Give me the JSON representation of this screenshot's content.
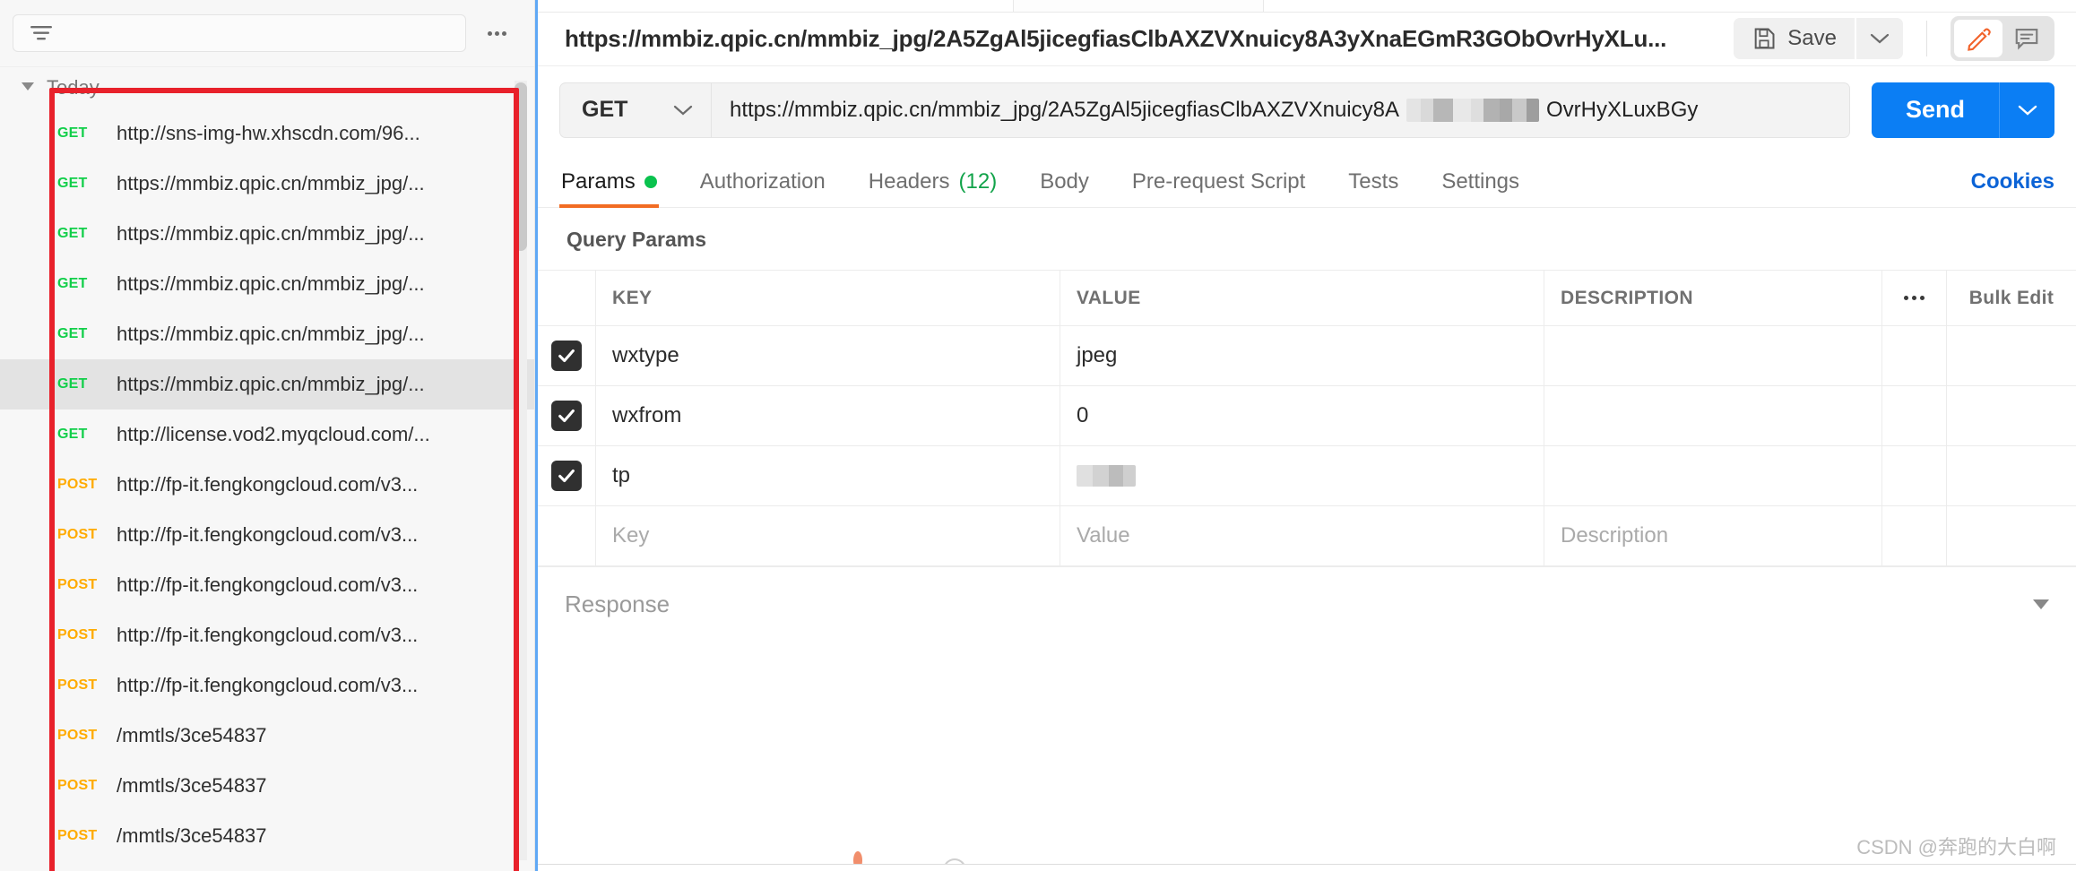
{
  "sidebar": {
    "filter_placeholder": "",
    "more_label": "more-options",
    "group": {
      "label": "Today"
    },
    "items": [
      {
        "method": "GET",
        "url": "http://sns-img-hw.xhscdn.com/96..."
      },
      {
        "method": "GET",
        "url": "https://mmbiz.qpic.cn/mmbiz_jpg/..."
      },
      {
        "method": "GET",
        "url": "https://mmbiz.qpic.cn/mmbiz_jpg/..."
      },
      {
        "method": "GET",
        "url": "https://mmbiz.qpic.cn/mmbiz_jpg/..."
      },
      {
        "method": "GET",
        "url": "https://mmbiz.qpic.cn/mmbiz_jpg/..."
      },
      {
        "method": "GET",
        "url": "https://mmbiz.qpic.cn/mmbiz_jpg/...",
        "selected": true
      },
      {
        "method": "GET",
        "url": "http://license.vod2.myqcloud.com/..."
      },
      {
        "method": "POST",
        "url": "http://fp-it.fengkongcloud.com/v3..."
      },
      {
        "method": "POST",
        "url": "http://fp-it.fengkongcloud.com/v3..."
      },
      {
        "method": "POST",
        "url": "http://fp-it.fengkongcloud.com/v3..."
      },
      {
        "method": "POST",
        "url": "http://fp-it.fengkongcloud.com/v3..."
      },
      {
        "method": "POST",
        "url": "http://fp-it.fengkongcloud.com/v3..."
      },
      {
        "method": "POST",
        "url": "/mmtls/3ce54837"
      },
      {
        "method": "POST",
        "url": "/mmtls/3ce54837"
      },
      {
        "method": "POST",
        "url": "/mmtls/3ce54837"
      }
    ]
  },
  "request": {
    "title": "https://mmbiz.qpic.cn/mmbiz_jpg/2A5ZgAl5jicegfiasClbAXZVXnuicy8A3yXnaEGmR3GObOvrHyXLu...",
    "save_label": "Save",
    "method": "GET",
    "url_prefix": "https://mmbiz.qpic.cn/mmbiz_jpg/2A5ZgAl5jicegfiasClbAXZVXnuicy8A",
    "url_suffix": "OvrHyXLuxBGy",
    "send_label": "Send",
    "cookies_label": "Cookies"
  },
  "tabs": [
    {
      "label": "Params",
      "active": true,
      "dot": true
    },
    {
      "label": "Authorization",
      "active": false
    },
    {
      "label": "Headers",
      "active": false,
      "count": "(12)"
    },
    {
      "label": "Body",
      "active": false
    },
    {
      "label": "Pre-request Script",
      "active": false
    },
    {
      "label": "Tests",
      "active": false
    },
    {
      "label": "Settings",
      "active": false
    }
  ],
  "params": {
    "section_title": "Query Params",
    "columns": {
      "key": "KEY",
      "value": "VALUE",
      "description": "DESCRIPTION",
      "bulk_edit": "Bulk Edit"
    },
    "rows": [
      {
        "checked": true,
        "key": "wxtype",
        "value": "jpeg",
        "description": ""
      },
      {
        "checked": true,
        "key": "wxfrom",
        "value": "0",
        "description": ""
      },
      {
        "checked": true,
        "key": "tp",
        "value": "",
        "description": "",
        "value_redacted": true
      }
    ],
    "new_row": {
      "key_placeholder": "Key",
      "value_placeholder": "Value",
      "description_placeholder": "Description"
    }
  },
  "response": {
    "label": "Response"
  },
  "watermark": {
    "text": "CSDN @奔跑的大白啊"
  },
  "colors": {
    "accent_blue": "#0b7ef4",
    "accent_orange": "#f26c23",
    "get_green": "#12cf4a",
    "post_orange": "#ffab00",
    "annotation_red": "#e8212b",
    "link_blue": "#0b63d6"
  }
}
